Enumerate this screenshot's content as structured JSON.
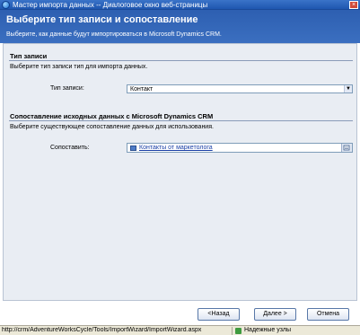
{
  "window": {
    "title": "Мастер импорта данных -- Диалоговое окно веб-страницы",
    "close_symbol": "×"
  },
  "header": {
    "title": "Выберите тип записи и сопоставление",
    "subtitle": "Выберите, как данные будут импортироваться в Microsoft Dynamics CRM."
  },
  "record_type_section": {
    "title": "Тип записи",
    "description": "Выберите тип записи тип для импорта данных.",
    "field_label": "Тип записи:",
    "selected_value": "Контакт",
    "dropdown_arrow": "▼"
  },
  "mapping_section": {
    "title": "Сопоставление исходных данных с Microsoft Dynamics CRM",
    "description": "Выберите существующее сопоставление данных для использования.",
    "field_label": "Сопоставить:",
    "selected_value": "Контакты от маркетолога"
  },
  "buttons": {
    "back": "<Назад",
    "next": "Далее >",
    "cancel": "Отмена"
  },
  "statusbar": {
    "url": "http://crm/AdventureWorksCycle/Tools/ImportWizard/ImportWizard.aspx",
    "zone": "Надежные узлы"
  }
}
